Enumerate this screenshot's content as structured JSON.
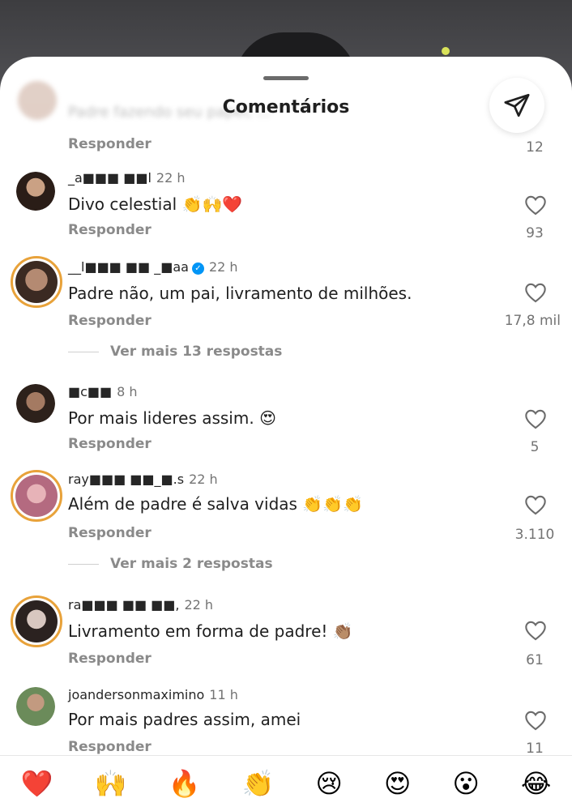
{
  "sheet": {
    "title": "Comentários"
  },
  "top_comment": {
    "text": "Padre fazendo seu papel, ...",
    "reply_label": "Responder",
    "likes": "12"
  },
  "comments": [
    {
      "user": "_a■■■ ■■l",
      "time": "22 h",
      "text": "Divo celestial 👏🙌❤️",
      "reply_label": "Responder",
      "likes": "93"
    },
    {
      "user": "__l■■■ ■■ _■aa",
      "time": "22 h",
      "verified": true,
      "text": "Padre não, um pai, livramento de milhões.",
      "reply_label": "Responder",
      "likes": "17,8 mil",
      "more": "Ver mais 13 respostas"
    },
    {
      "user": "■c■■",
      "time": "8 h",
      "text": "Por mais lideres assim. 😍",
      "reply_label": "Responder",
      "likes": "5"
    },
    {
      "user": "ray■■■ ■■_■.s",
      "time": "22 h",
      "text": "Além de padre é salva vidas 👏👏👏",
      "reply_label": "Responder",
      "likes": "3.110",
      "more": "Ver mais 2 respostas"
    },
    {
      "user": "ra■■■ ■■ ■■,",
      "time": "22 h",
      "text": "Livramento em forma de padre! 👏🏽",
      "reply_label": "Responder",
      "likes": "61"
    },
    {
      "user": "joandersonmaximino",
      "time": "11 h",
      "text": "Por mais padres assim, amei",
      "reply_label": "Responder",
      "likes": "11"
    }
  ],
  "reactions": [
    "❤️",
    "🙌",
    "🔥",
    "👏",
    "😢",
    "😍",
    "😮",
    "😂"
  ],
  "icons": {
    "share": "paper-plane-icon",
    "like": "heart-outline-icon"
  },
  "colors": {
    "accent": "#0095f6",
    "story_ring": "#e8a23a",
    "muted": "#8a8a8a"
  }
}
